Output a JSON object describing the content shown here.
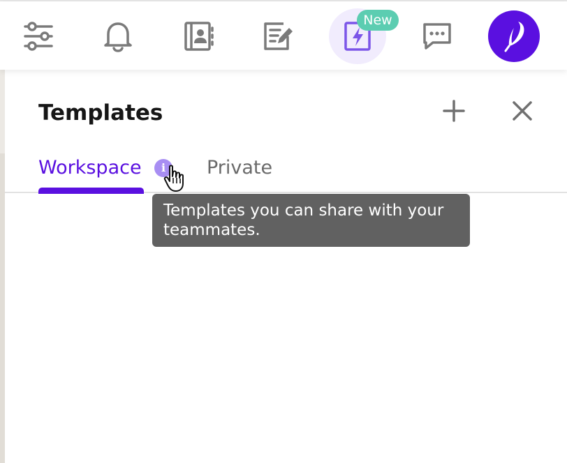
{
  "toolbar": {
    "buttons": [
      {
        "icon": "sliders-icon"
      },
      {
        "icon": "bell-icon"
      },
      {
        "icon": "contacts-book-icon"
      },
      {
        "icon": "notes-edit-icon"
      },
      {
        "icon": "lightning-template-icon",
        "active": true
      },
      {
        "icon": "chat-bubble-icon"
      }
    ],
    "new_badge": "New",
    "avatar_icon": "quill-feather-icon"
  },
  "panel": {
    "title": "Templates",
    "add_icon": "plus-icon",
    "close_icon": "close-icon"
  },
  "tabs": [
    {
      "label": "Workspace",
      "active": true
    },
    {
      "label": "Private",
      "active": false
    }
  ],
  "info_icon_glyph": "i",
  "tooltip": {
    "text": "Templates you can share with your teammates."
  },
  "colors": {
    "accent": "#5a10e0",
    "icon_gray": "#7a7a7a",
    "badge": "#5ccdb1",
    "active_bg": "#f1ecfd",
    "tooltip_bg": "#616161",
    "info_icon": "#a88ef3"
  }
}
